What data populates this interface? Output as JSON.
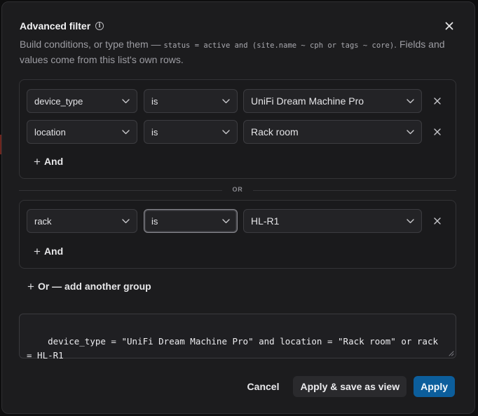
{
  "dialog": {
    "title": "Advanced filter",
    "subtitle_lead": "Build conditions, or type them — ",
    "subtitle_code": "status = active and (site.name ~ cph or tags ~ core)",
    "subtitle_tail": ". Fields and values come from this list's own rows."
  },
  "groups": [
    {
      "rows": [
        {
          "field": "device_type",
          "operator": "is",
          "value": "UniFi Dream Machine Pro"
        },
        {
          "field": "location",
          "operator": "is",
          "value": "Rack room"
        }
      ],
      "and_label": "And"
    },
    {
      "rows": [
        {
          "field": "rack",
          "operator": "is",
          "value": "HL-R1"
        }
      ],
      "and_label": "And"
    }
  ],
  "or_label": "OR",
  "add_group_label": "Or — add another group",
  "query_text": "device_type = \"UniFi Dream Machine Pro\" and location = \"Rack room\" or rack = HL-R1",
  "footer": {
    "cancel": "Cancel",
    "save_view": "Apply & save as view",
    "apply": "Apply"
  },
  "colors": {
    "primary": "#0c5e9c",
    "surface": "#1c1c1e",
    "border": "#333336"
  },
  "icons": {
    "info": "info-icon",
    "close": "close-icon",
    "chevron": "chevron-down-icon",
    "remove": "remove-icon",
    "plus": "plus-icon"
  }
}
